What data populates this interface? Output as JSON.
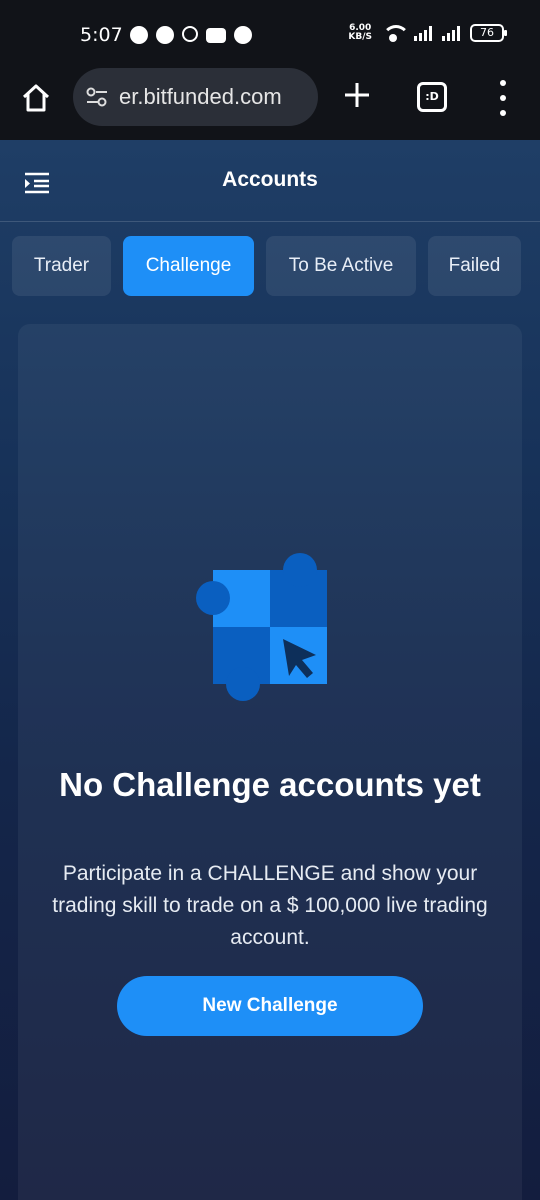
{
  "status_bar": {
    "time": "5:07",
    "net_speed_value": "6.00",
    "net_speed_unit": "KB/S",
    "battery": "76",
    "icons": [
      "chat-icon",
      "messenger-icon",
      "app-icon",
      "youtube-icon",
      "bitfunded-icon",
      "wifi-icon",
      "signal-icon",
      "signal-icon",
      "battery-icon"
    ]
  },
  "browser": {
    "url": "er.bitfunded.com",
    "tabs_label": ":D",
    "icons": [
      "home-icon",
      "site-settings-icon",
      "new-tab-icon",
      "tabs-icon",
      "menu-icon"
    ]
  },
  "app": {
    "title": "Accounts",
    "tabs": [
      {
        "label": "Trader",
        "active": false
      },
      {
        "label": "Challenge",
        "active": true
      },
      {
        "label": "To Be Active",
        "active": false
      },
      {
        "label": "Failed",
        "active": false
      }
    ],
    "empty_state": {
      "title": "No Challenge accounts yet",
      "description": "Participate in a CHALLENGE and show your trading skill to trade on a $ 100,000 live trading account.",
      "button_label": "New Challenge"
    },
    "colors": {
      "accent": "#1e8ff7",
      "accent_dark": "#0a5fc0"
    }
  }
}
